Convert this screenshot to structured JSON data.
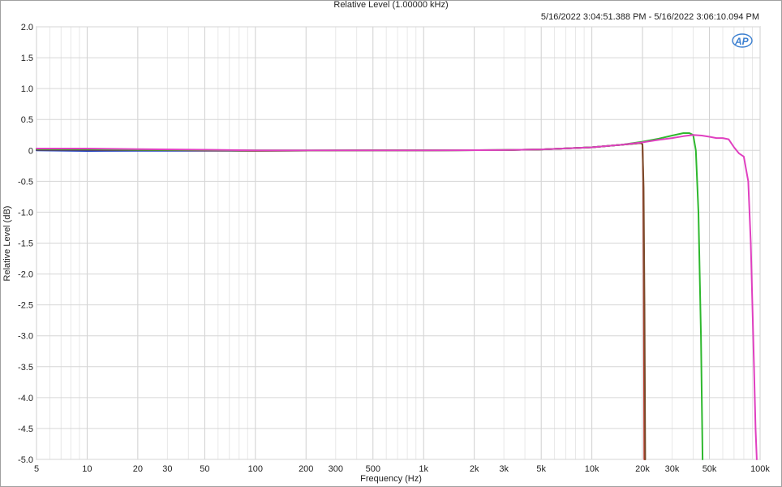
{
  "chart_data": {
    "type": "line",
    "title": "Relative Level (1.00000 kHz)",
    "subtitle": "5/16/2022 3:04:51.388 PM - 5/16/2022 3:06:10.094 PM",
    "xlabel": "Frequency (Hz)",
    "ylabel": "Relative Level (dB)",
    "x_scale": "log",
    "xlim": [
      5,
      100000
    ],
    "ylim": [
      -5.0,
      2.0
    ],
    "grid": true,
    "x_ticks": [
      5,
      10,
      20,
      30,
      50,
      100,
      200,
      300,
      500,
      1000,
      2000,
      3000,
      5000,
      10000,
      20000,
      30000,
      50000,
      100000
    ],
    "x_tick_labels": [
      "5",
      "10",
      "20",
      "30",
      "50",
      "100",
      "200",
      "300",
      "500",
      "1k",
      "2k",
      "3k",
      "5k",
      "10k",
      "20k",
      "30k",
      "50k",
      "100k"
    ],
    "y_ticks": [
      2.0,
      1.5,
      1.0,
      0.5,
      0,
      -0.5,
      -1.0,
      -1.5,
      -2.0,
      -2.5,
      -3.0,
      -3.5,
      -4.0,
      -4.5,
      -5.0
    ],
    "y_tick_labels": [
      "2.0",
      "1.5",
      "1.0",
      "0.5",
      "0",
      "-0.5",
      "-1.0",
      "-1.5",
      "-2.0",
      "-2.5",
      "-3.0",
      "-3.5",
      "-4.0",
      "-4.5",
      "-5.0"
    ],
    "series": [
      {
        "color": "#1f3fbf",
        "x": [
          5,
          10,
          20,
          50,
          100,
          500,
          1000,
          3000,
          5000,
          10000,
          15000,
          18000,
          19500
        ],
        "y": [
          0.0,
          -0.01,
          -0.005,
          -0.005,
          -0.005,
          0.0,
          0.0,
          0.005,
          0.015,
          0.05,
          0.09,
          0.11,
          0.12
        ]
      },
      {
        "color": "#c0392b",
        "x": [
          5,
          10,
          20,
          50,
          100,
          500,
          1000,
          3000,
          5000,
          10000,
          15000,
          18000,
          19500,
          20000,
          20200,
          20350,
          20500
        ],
        "y": [
          0.02,
          0.015,
          0.01,
          0.0,
          -0.005,
          0.0,
          0.0,
          0.005,
          0.015,
          0.05,
          0.09,
          0.11,
          0.12,
          0.1,
          -0.5,
          -2.0,
          -5.0
        ]
      },
      {
        "color": "#7a4a2a",
        "x": [
          5,
          10,
          20,
          50,
          100,
          500,
          1000,
          3000,
          5000,
          10000,
          15000,
          18000,
          19500,
          20000,
          20300,
          20550,
          20750
        ],
        "y": [
          0.01,
          0.01,
          0.005,
          0.0,
          -0.005,
          0.0,
          0.0,
          0.005,
          0.015,
          0.05,
          0.09,
          0.11,
          0.12,
          0.1,
          -0.6,
          -2.5,
          -5.0
        ]
      },
      {
        "color": "#2eb82e",
        "x": [
          5,
          10,
          20,
          50,
          100,
          500,
          1000,
          3000,
          5000,
          10000,
          15000,
          20000,
          25000,
          30000,
          35000,
          38000,
          40000,
          41500,
          43000,
          44500,
          45500
        ],
        "y": [
          0.02,
          0.02,
          0.01,
          0.005,
          0.0,
          0.0,
          0.0,
          0.005,
          0.015,
          0.05,
          0.09,
          0.14,
          0.19,
          0.24,
          0.28,
          0.28,
          0.25,
          0.0,
          -1.0,
          -3.0,
          -5.0
        ]
      },
      {
        "color": "#e040c0",
        "x": [
          5,
          10,
          20,
          50,
          100,
          500,
          1000,
          3000,
          5000,
          10000,
          15000,
          20000,
          25000,
          30000,
          35000,
          40000,
          45000,
          50000,
          55000,
          60000,
          65000,
          70000,
          75000,
          80000,
          85000,
          88000,
          90000,
          92000,
          94000,
          95500
        ],
        "y": [
          0.03,
          0.03,
          0.02,
          0.01,
          0.0,
          0.0,
          0.0,
          0.005,
          0.015,
          0.05,
          0.09,
          0.13,
          0.17,
          0.2,
          0.23,
          0.25,
          0.24,
          0.22,
          0.2,
          0.2,
          0.18,
          0.05,
          -0.05,
          -0.1,
          -0.5,
          -1.5,
          -2.5,
          -3.5,
          -4.5,
          -5.0
        ]
      }
    ]
  }
}
